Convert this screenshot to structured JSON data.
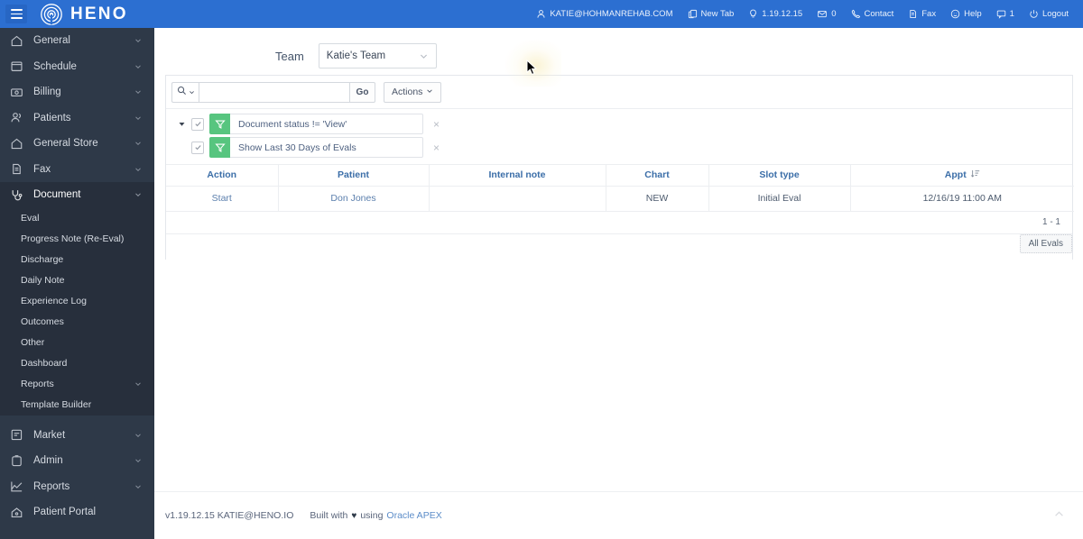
{
  "topbar": {
    "brand": "HENO",
    "menu_icon": "hamburger-icon",
    "logo_icon": "heno-target-logo",
    "items": [
      {
        "label": "KATIE@HOHMANREHAB.COM",
        "icon": "user-icon"
      },
      {
        "label": "New Tab",
        "icon": "new-tab-icon"
      },
      {
        "label": "1.19.12.15",
        "icon": "lightbulb-icon"
      },
      {
        "label": "0",
        "icon": "envelope-icon"
      },
      {
        "label": "Contact",
        "icon": "phone-icon"
      },
      {
        "label": "Fax",
        "icon": "fax-icon"
      },
      {
        "label": "Help",
        "icon": "smiley-icon"
      },
      {
        "label": "1",
        "icon": "chat-icon"
      },
      {
        "label": "Logout",
        "icon": "power-icon"
      }
    ]
  },
  "sidebar": {
    "items": [
      {
        "label": "General",
        "icon": "home-icon",
        "chevron": true,
        "active": false
      },
      {
        "label": "Schedule",
        "icon": "calendar-icon",
        "chevron": true,
        "active": false
      },
      {
        "label": "Billing",
        "icon": "money-icon",
        "chevron": true,
        "active": false
      },
      {
        "label": "Patients",
        "icon": "patients-icon",
        "chevron": true,
        "active": false
      },
      {
        "label": "General Store",
        "icon": "store-icon",
        "chevron": true,
        "active": false
      },
      {
        "label": "Fax",
        "icon": "fax-icon",
        "chevron": true,
        "active": false
      },
      {
        "label": "Document",
        "icon": "stethoscope-icon",
        "chevron": true,
        "active": true
      }
    ],
    "document_subitems": [
      {
        "label": "Eval",
        "chevron": false
      },
      {
        "label": "Progress Note (Re-Eval)",
        "chevron": false
      },
      {
        "label": "Discharge",
        "chevron": false
      },
      {
        "label": "Daily Note",
        "chevron": false
      },
      {
        "label": "Experience Log",
        "chevron": false
      },
      {
        "label": "Outcomes",
        "chevron": false
      },
      {
        "label": "Other",
        "chevron": false
      },
      {
        "label": "Dashboard",
        "chevron": false
      },
      {
        "label": "Reports",
        "chevron": true
      },
      {
        "label": "Template Builder",
        "chevron": false
      }
    ],
    "items_bottom": [
      {
        "label": "Market",
        "icon": "market-icon",
        "chevron": true
      },
      {
        "label": "Admin",
        "icon": "admin-icon",
        "chevron": true
      },
      {
        "label": "Reports",
        "icon": "chart-icon",
        "chevron": true
      },
      {
        "label": "Patient Portal",
        "icon": "portal-home-icon",
        "chevron": false
      }
    ]
  },
  "team": {
    "label": "Team",
    "selected": "Katie's Team"
  },
  "search": {
    "value": "",
    "placeholder": "",
    "go_label": "Go",
    "actions_label": "Actions",
    "search_icon": "magnifier-icon"
  },
  "filters": [
    {
      "label": "Document status != 'View'",
      "checked": true,
      "icon": "funnel-icon",
      "close": "×"
    },
    {
      "label": "Show Last 30 Days of Evals",
      "checked": true,
      "icon": "funnel-icon",
      "close": "×"
    }
  ],
  "table": {
    "columns": [
      "Action",
      "Patient",
      "Internal note",
      "Chart",
      "Slot type",
      "Appt"
    ],
    "sort_column": "Appt",
    "sort_direction": "descending",
    "rows": [
      {
        "action": "Start",
        "patient": "Don Jones",
        "internal_note": "",
        "chart": "NEW",
        "slot_type": "Initial Eval",
        "appt": "12/16/19 11:00 AM"
      }
    ],
    "pagination": "1 - 1",
    "tab_label": "All Evals"
  },
  "footer": {
    "version": "v1.19.12.15 KATIE@HENO.IO",
    "built_prefix": "Built with",
    "heart": "♥",
    "built_suffix": "using",
    "apex": "Oracle APEX",
    "collapse_icon": "chevron-up-icon"
  },
  "colors": {
    "topbar_blue": "#2c6fd1",
    "sidebar_dark": "#2e3948",
    "sidebar_active": "#272f3c",
    "filter_green": "#57c57f",
    "link_blue": "#3b6ea8"
  }
}
